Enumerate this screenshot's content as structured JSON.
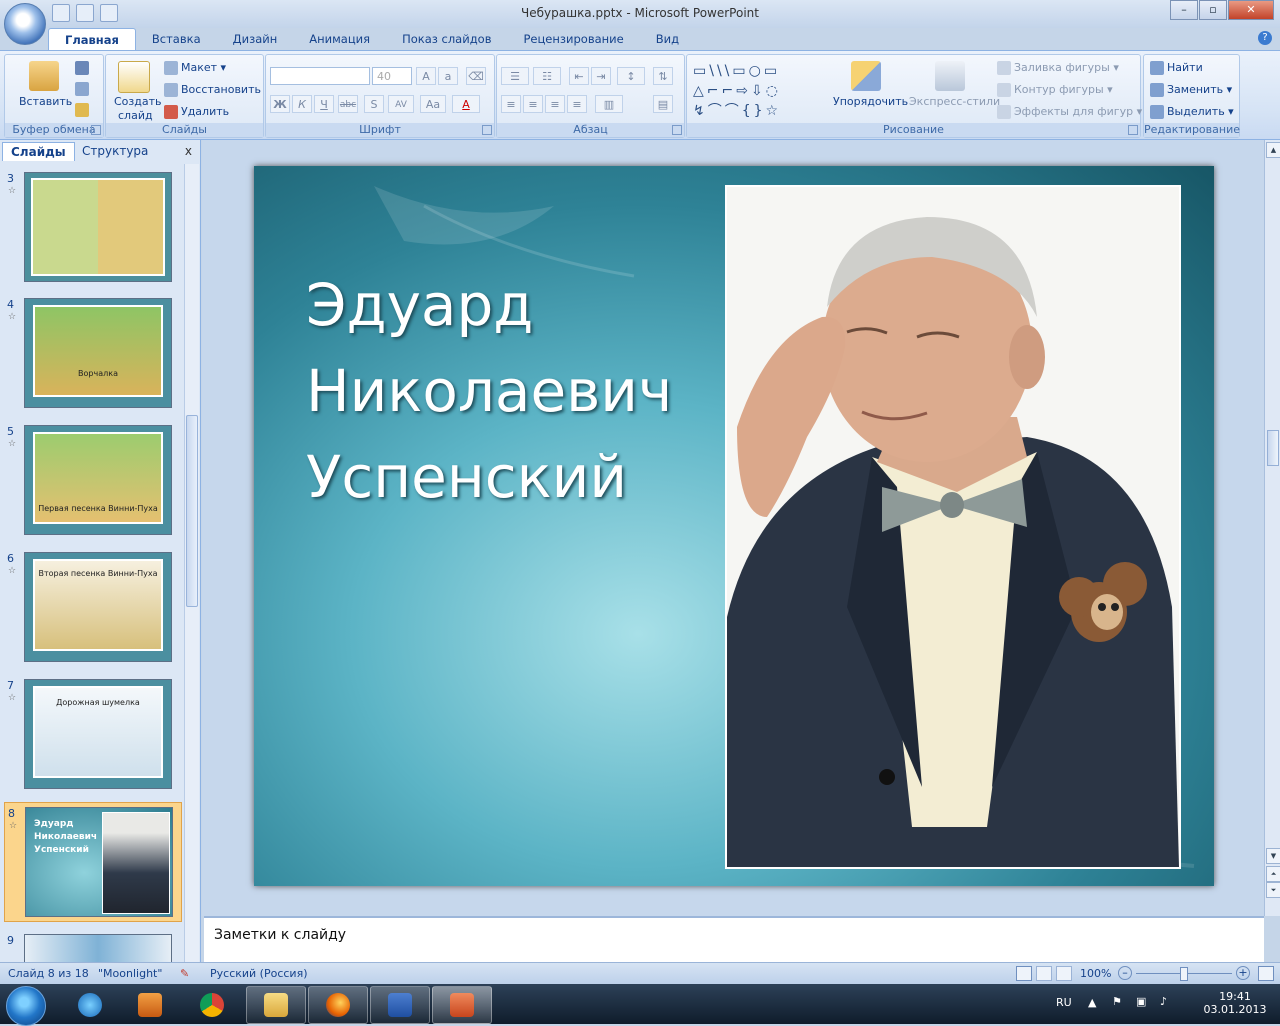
{
  "window": {
    "title": "Чебурашка.pptx - Microsoft PowerPoint"
  },
  "tabs": [
    "Главная",
    "Вставка",
    "Дизайн",
    "Анимация",
    "Показ слайдов",
    "Рецензирование",
    "Вид"
  ],
  "ribbon": {
    "clipboard": {
      "paste": "Вставить",
      "group": "Буфер обмена"
    },
    "slides": {
      "new_slide_1": "Создать",
      "new_slide_2": "слайд",
      "layout": "Макет",
      "reset": "Восстановить",
      "delete": "Удалить",
      "group": "Слайды"
    },
    "font": {
      "size": "40",
      "group": "Шрифт",
      "bold": "Ж",
      "italic": "К",
      "underline": "Ч",
      "strike": "abc",
      "shadow": "S",
      "spacing": "AV",
      "case": "Aa",
      "color": "A"
    },
    "paragraph": {
      "group": "Абзац"
    },
    "drawing": {
      "arrange": "Упорядочить",
      "quick_styles": "Экспресс-стили",
      "fill": "Заливка фигуры",
      "outline": "Контур фигуры",
      "effects": "Эффекты для фигур",
      "group": "Рисование"
    },
    "editing": {
      "find": "Найти",
      "replace": "Заменить",
      "select": "Выделить",
      "group": "Редактирование"
    }
  },
  "panel": {
    "tab_slides": "Слайды",
    "tab_outline": "Структура",
    "close": "x",
    "thumbs": [
      {
        "num": "3",
        "caption": ""
      },
      {
        "num": "4",
        "caption": "Ворчалка"
      },
      {
        "num": "5",
        "caption": "Первая песенка Винни-Пуха"
      },
      {
        "num": "6",
        "caption": "Вторая песенка Винни-Пуха"
      },
      {
        "num": "7",
        "caption": "Дорожная шумелка"
      },
      {
        "num": "8",
        "caption": "Эдуард Николаевич Успенский"
      },
      {
        "num": "9",
        "caption": ""
      }
    ]
  },
  "slide": {
    "title_lines": [
      "Эдуард",
      "Николаевич",
      "Успенский"
    ]
  },
  "notes": {
    "placeholder": "Заметки к слайду"
  },
  "status": {
    "slide_info": "Слайд 8 из 18",
    "theme": "\"Moonlight\"",
    "language": "Русский (Россия)",
    "zoom": "100%"
  },
  "tray": {
    "lang": "RU",
    "time": "19:41",
    "date": "03.01.2013"
  },
  "colors": {
    "accent": "#15428b",
    "slide_bg": "#2e8296"
  }
}
